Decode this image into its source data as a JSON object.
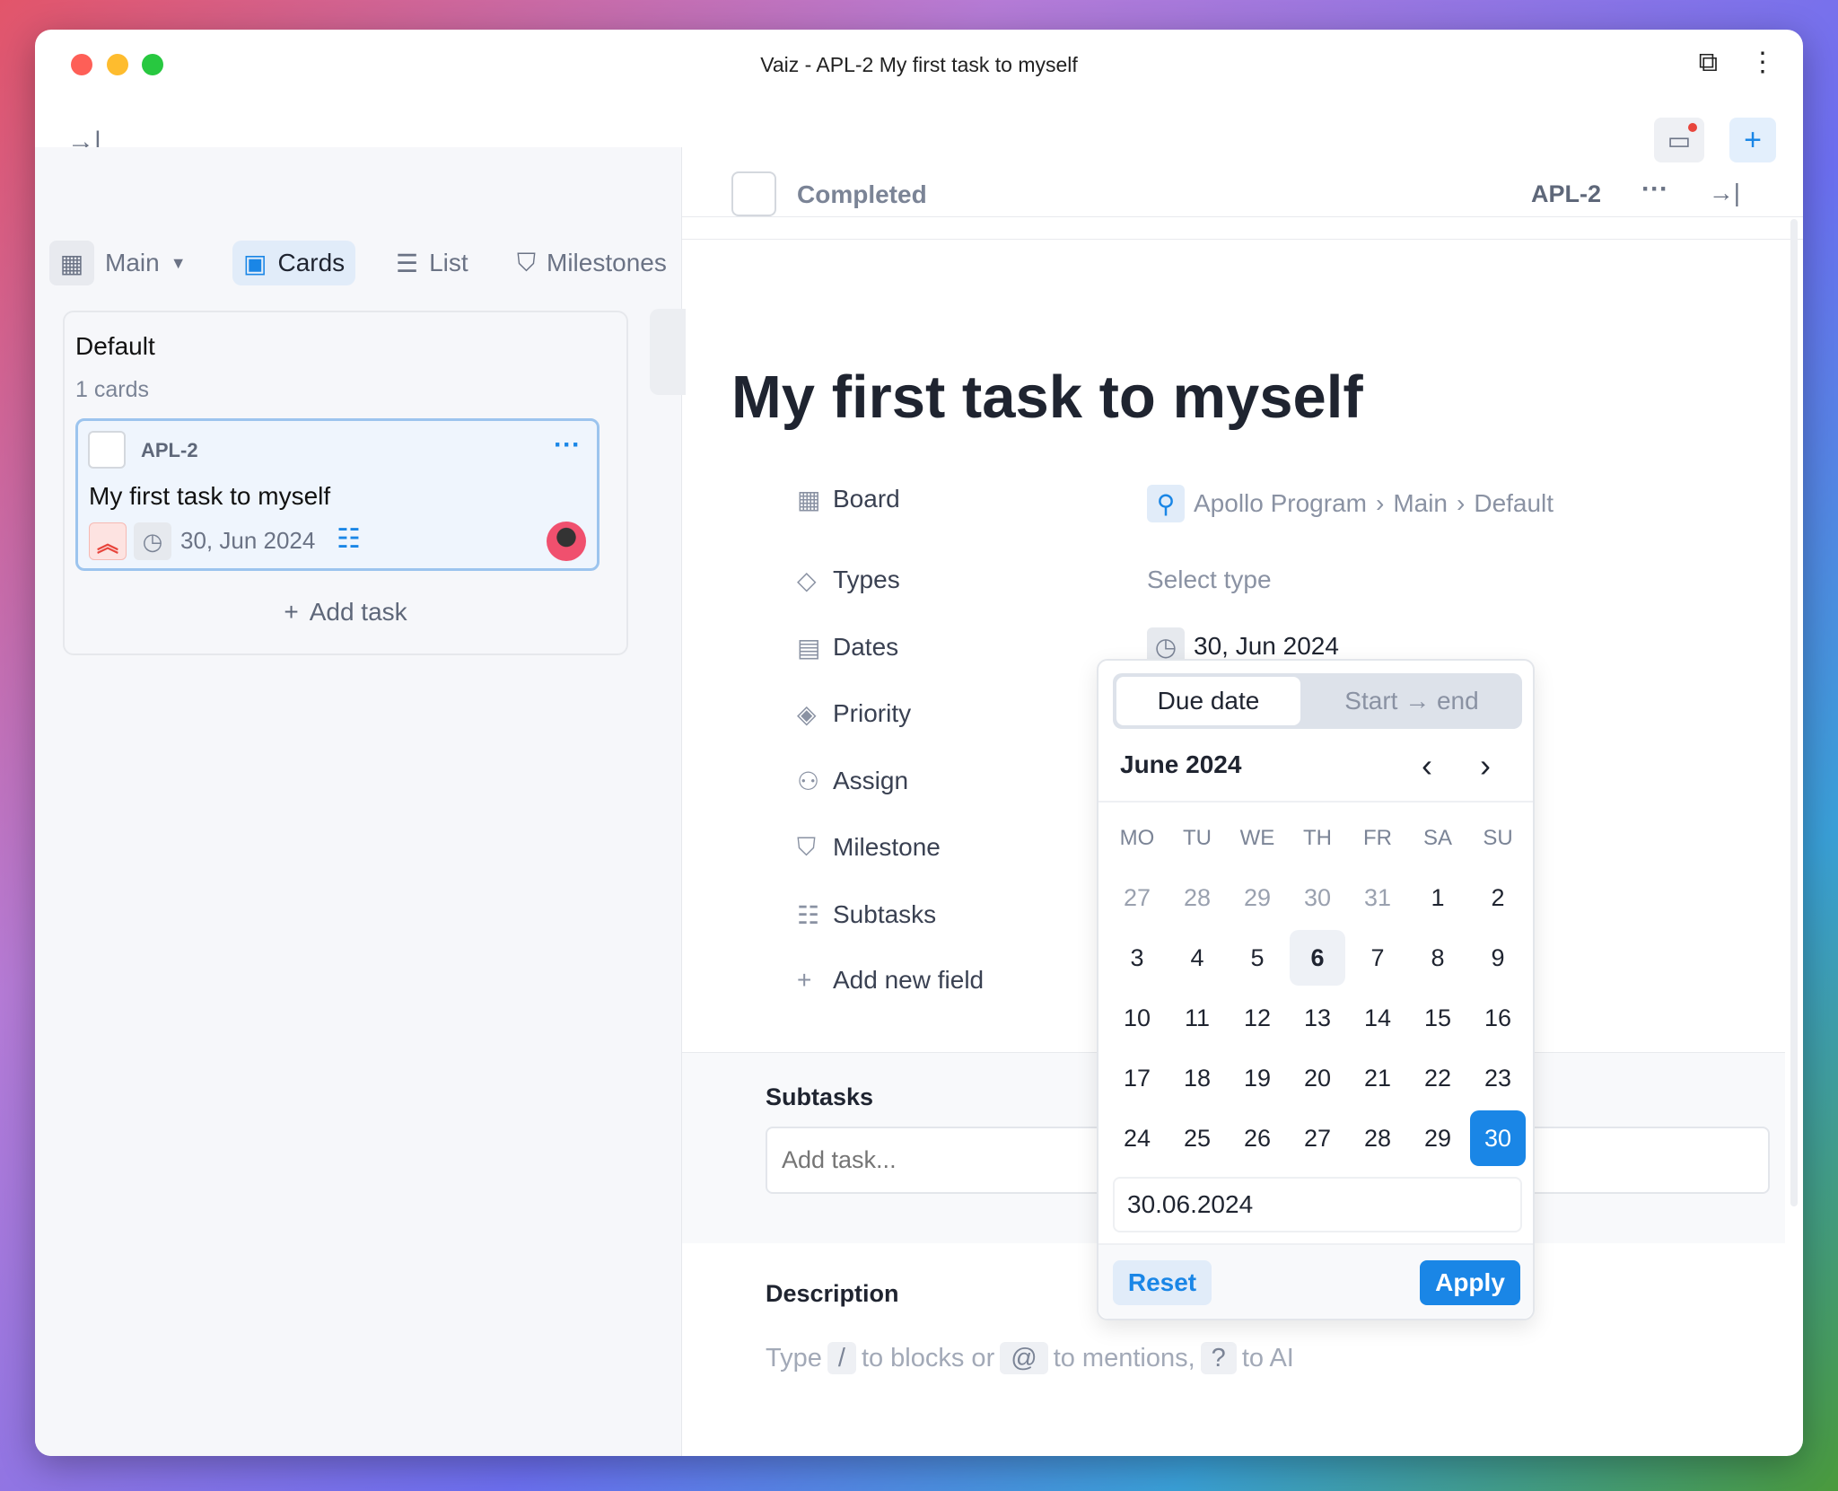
{
  "window": {
    "title": "Vaiz - APL-2 My first task to myself"
  },
  "board_tabs": {
    "board": "Main",
    "tabs": [
      {
        "label": "Cards",
        "active": true
      },
      {
        "label": "List"
      },
      {
        "label": "Milestones"
      }
    ]
  },
  "column": {
    "name": "Default",
    "count": "1 cards",
    "add_task": "Add task"
  },
  "card": {
    "id": "APL-2",
    "title": "My first task to myself",
    "date": "30, Jun 2024",
    "priority_icon": "double-chevron-up-icon"
  },
  "task": {
    "status": "Completed",
    "id": "APL-2",
    "title": "My first task to myself",
    "fields": [
      {
        "label": "Board",
        "icon": "board-icon"
      },
      {
        "label": "Types",
        "icon": "tag-icon"
      },
      {
        "label": "Dates",
        "icon": "calendar-icon"
      },
      {
        "label": "Priority",
        "icon": "diamond-icon"
      },
      {
        "label": "Assign",
        "icon": "users-icon"
      },
      {
        "label": "Milestone",
        "icon": "milestone-icon"
      },
      {
        "label": "Subtasks",
        "icon": "list-icon"
      },
      {
        "label": "Add new field",
        "icon": "plus-icon"
      }
    ],
    "board_path": [
      "Apollo Program",
      "Main",
      "Default"
    ],
    "types_placeholder": "Select type",
    "date": "30, Jun 2024",
    "subtasks_heading": "Subtasks",
    "subtask_placeholder": "Add task...",
    "description_heading": "Description",
    "desc_placeholder": {
      "a": "Type",
      "k1": "/",
      "b": "to blocks or",
      "k2": "@",
      "c": "to mentions,",
      "k3": "?",
      "d": "to AI"
    }
  },
  "datepicker": {
    "modes": [
      "Due date",
      "Start → end"
    ],
    "active_mode": "Due date",
    "month": "June 2024",
    "weekdays": [
      "MO",
      "TU",
      "WE",
      "TH",
      "FR",
      "SA",
      "SU"
    ],
    "days": [
      [
        "27",
        "28",
        "29",
        "30",
        "31",
        "1",
        "2"
      ],
      [
        "3",
        "4",
        "5",
        "6",
        "7",
        "8",
        "9"
      ],
      [
        "10",
        "11",
        "12",
        "13",
        "14",
        "15",
        "16"
      ],
      [
        "17",
        "18",
        "19",
        "20",
        "21",
        "22",
        "23"
      ],
      [
        "24",
        "25",
        "26",
        "27",
        "28",
        "29",
        "30"
      ]
    ],
    "today": "6",
    "selected": "30",
    "input_value": "30.06.2024",
    "reset": "Reset",
    "apply": "Apply"
  },
  "colors": {
    "accent": "#1a86e6",
    "priority": "#e8453c"
  }
}
